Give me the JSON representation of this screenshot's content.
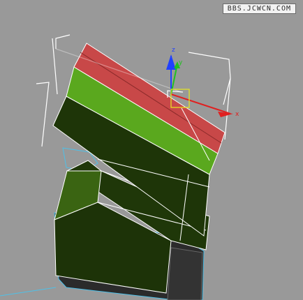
{
  "watermark": {
    "text": "BBS.JCWCN.COM"
  },
  "gizmo": {
    "x_label": "x",
    "y_label": "y",
    "z_label": "z",
    "x_color": "#e02020",
    "y_color": "#20c020",
    "z_color": "#2040ff"
  },
  "colors": {
    "background": "#999999",
    "red_face": "#c84848",
    "green_face_light": "#5aa81e",
    "dark_face": "#1e3508",
    "bounding_box": "#ffffff",
    "lower_wire": "#4ec0e8"
  }
}
